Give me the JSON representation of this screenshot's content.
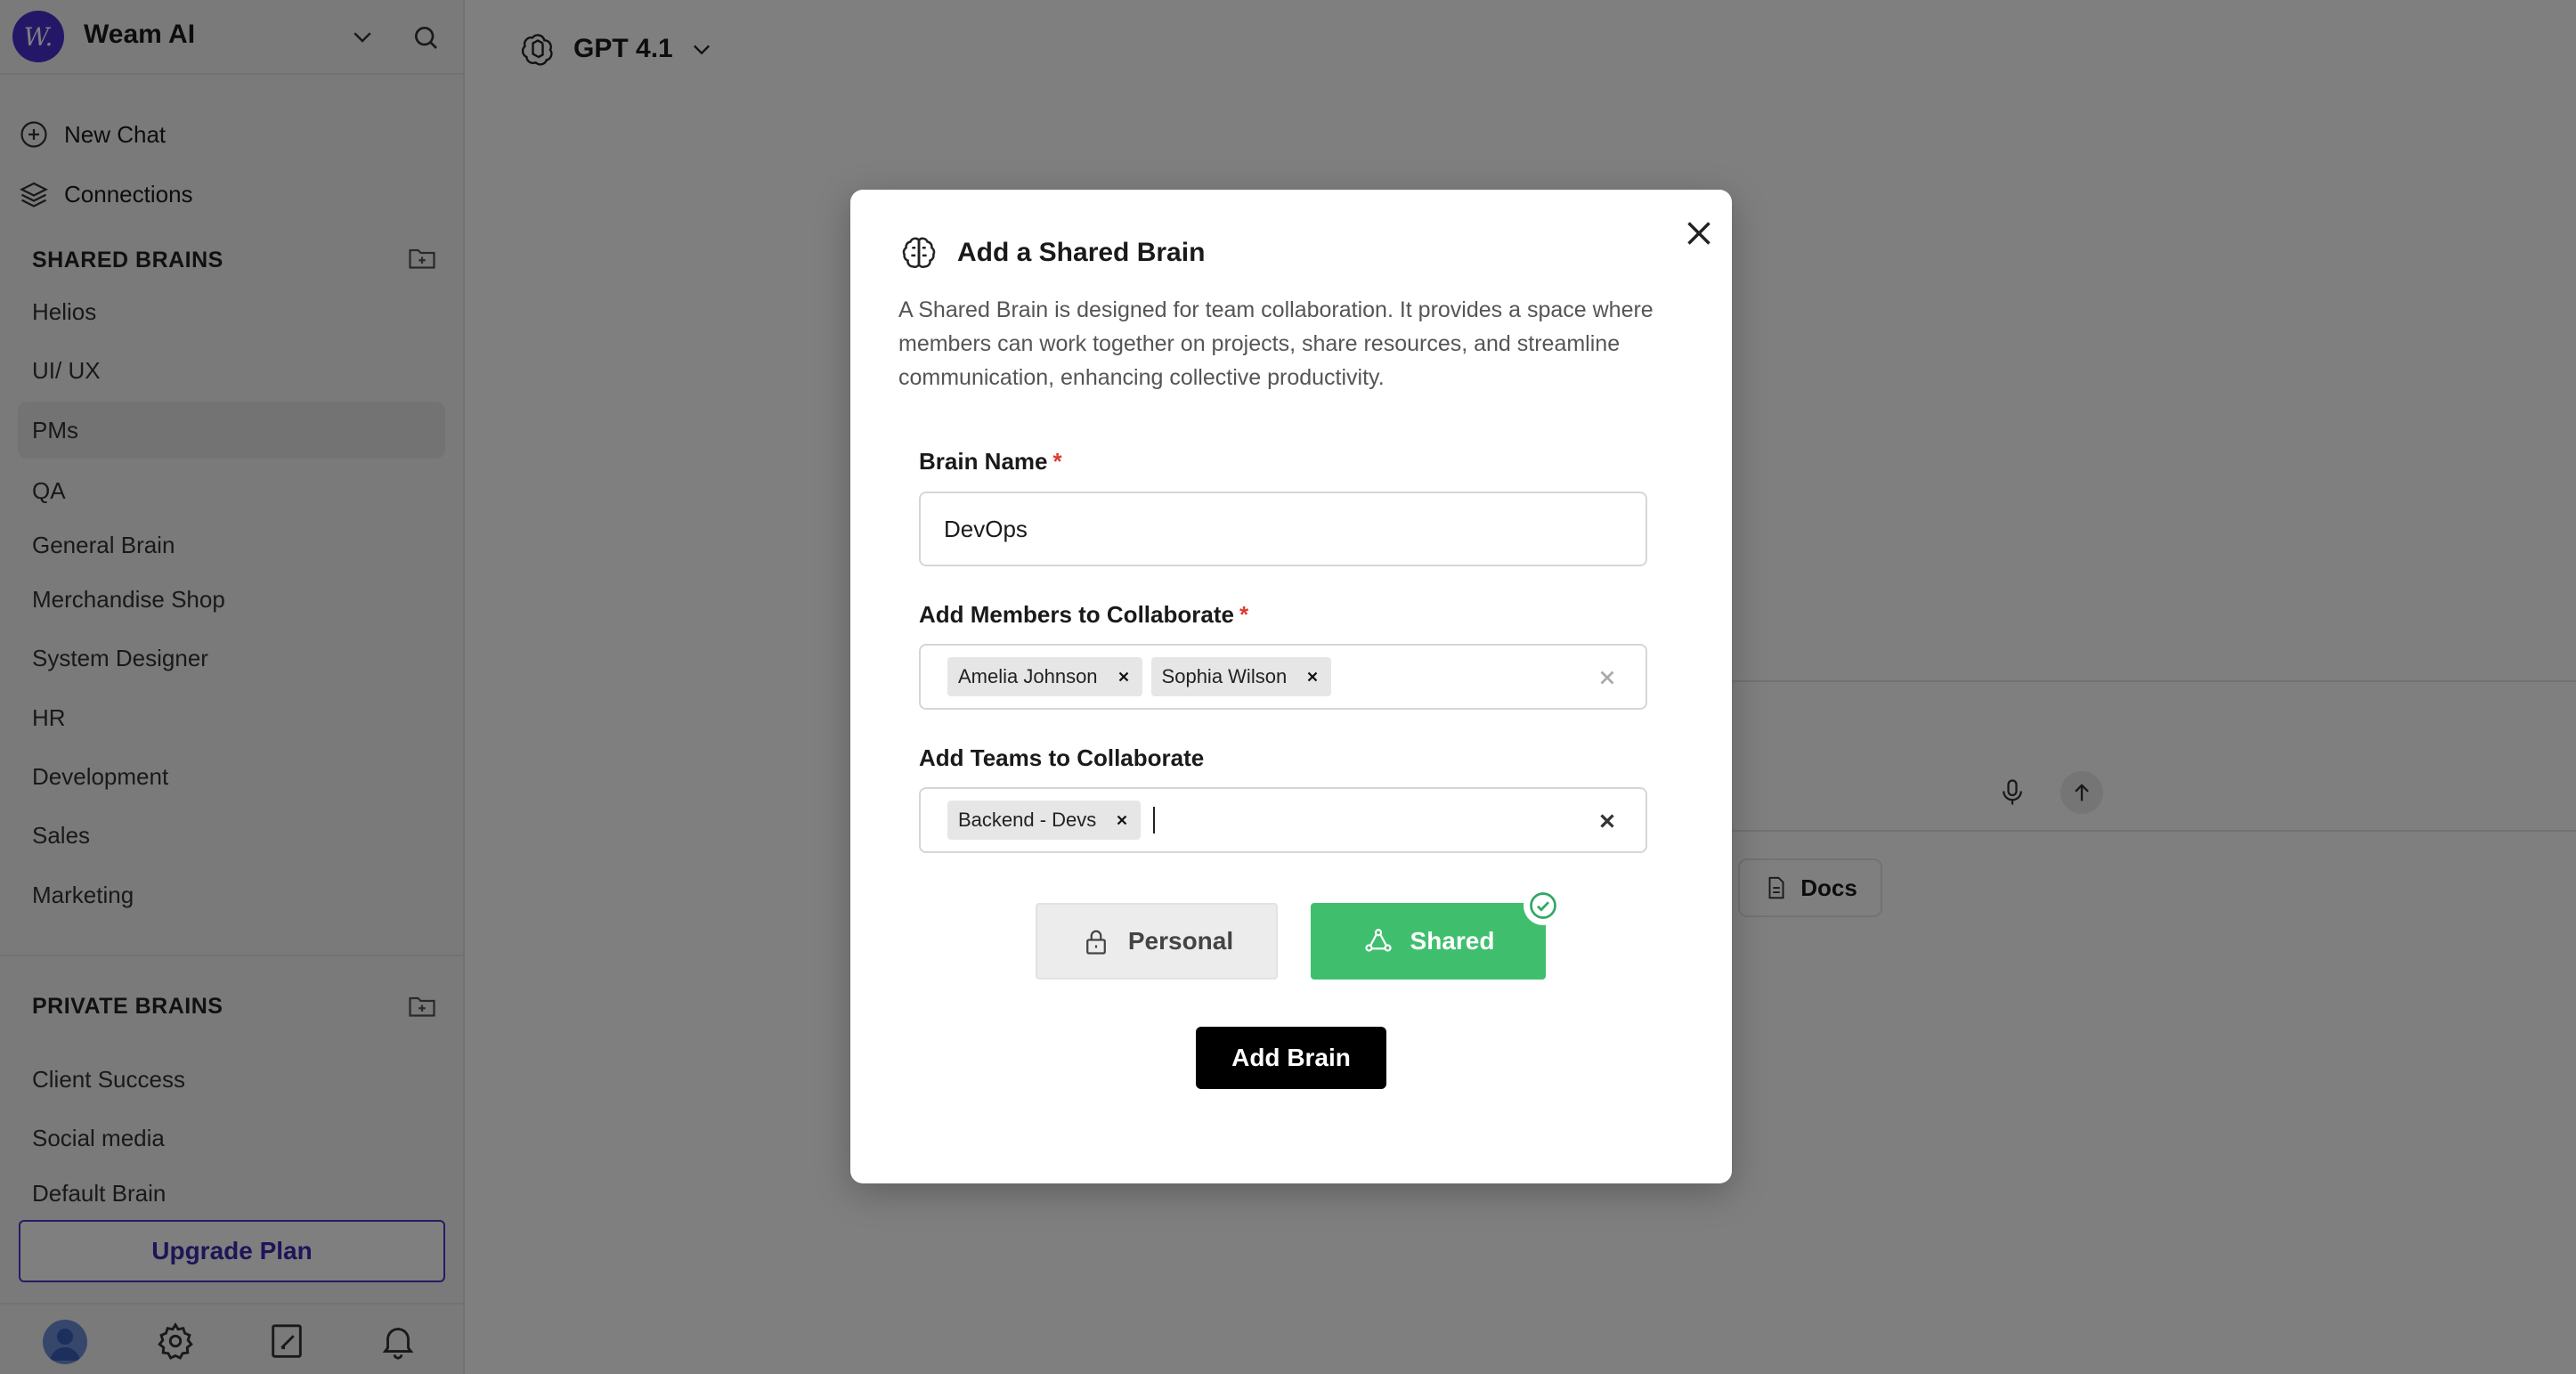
{
  "sidebar": {
    "logo_text": "W.",
    "workspace_name": "Weam AI",
    "nav": [
      {
        "label": "New Chat",
        "icon": "plus-circle-icon"
      },
      {
        "label": "Connections",
        "icon": "layers-icon"
      }
    ],
    "shared_brains": {
      "title": "SHARED BRAINS",
      "items": [
        "Helios",
        "UI/ UX",
        "PMs",
        "QA",
        "General Brain",
        "Merchandise Shop",
        "System Designer",
        "HR",
        "Development",
        "Sales",
        "Marketing"
      ],
      "active": "PMs"
    },
    "private_brains": {
      "title": "PRIVATE BRAINS",
      "items": [
        "Client Success",
        "Social media",
        "Default Brain"
      ]
    },
    "upgrade_label": "Upgrade Plan"
  },
  "main": {
    "model_label": "GPT 4.1",
    "docs_label": "Docs"
  },
  "modal": {
    "title": "Add a Shared Brain",
    "description": "A Shared Brain is designed for team collaboration. It provides a space where members can work together on projects, share resources, and streamline communication, enhancing collective productivity.",
    "brain_name": {
      "label": "Brain Name",
      "required_mark": "*",
      "value": "DevOps"
    },
    "members": {
      "label": "Add Members to Collaborate",
      "required_mark": "*",
      "tags": [
        "Amelia Johnson",
        "Sophia Wilson"
      ]
    },
    "teams": {
      "label": "Add Teams to Collaborate",
      "tags": [
        "Backend - Devs"
      ]
    },
    "type_personal": "Personal",
    "type_shared": "Shared",
    "selected_type": "Shared",
    "submit_label": "Add Brain"
  },
  "colors": {
    "accent": "#4a2ed1",
    "shared_green": "#3fbf6e",
    "required_red": "#e0392e",
    "overlay": "rgba(0,0,0,0.5)"
  }
}
